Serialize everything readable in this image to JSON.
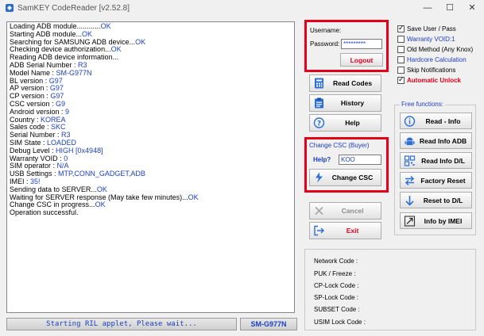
{
  "window": {
    "title": "SamKEY CodeReader [v2.52.8]",
    "minimize_glyph": "—",
    "maximize_glyph": "☐",
    "close_glyph": "✕"
  },
  "log": [
    {
      "t": "Loading ADB module............",
      "v": "OK"
    },
    {
      "t": "Starting ADB module...",
      "v": "OK"
    },
    {
      "t": "Searching for SAMSUNG ADB device...",
      "v": "OK"
    },
    {
      "t": "Checking device authorization...",
      "v": "OK"
    },
    {
      "t": "Reading ADB device information...",
      "v": ""
    },
    {
      "t": "ADB Serial Number : ",
      "v": "R3"
    },
    {
      "t": "Model Name : ",
      "v": "SM-G977N"
    },
    {
      "t": "BL version : ",
      "v": "G97"
    },
    {
      "t": "AP version : ",
      "v": "G97"
    },
    {
      "t": "CP version : ",
      "v": "G97"
    },
    {
      "t": "CSC version : ",
      "v": "G9"
    },
    {
      "t": "Android version : ",
      "v": "9"
    },
    {
      "t": "Country : ",
      "v": "KOREA"
    },
    {
      "t": "Sales code : ",
      "v": "SKC"
    },
    {
      "t": "Serial Number : ",
      "v": "R3"
    },
    {
      "t": "SIM State : ",
      "v": "LOADED"
    },
    {
      "t": "Debug Level : ",
      "v": "HIGH [0x4948]"
    },
    {
      "t": "Warranty VOID : ",
      "v": "0"
    },
    {
      "t": "SIM operator : ",
      "v": "N/A"
    },
    {
      "t": "USB Settings : ",
      "v": "MTP,CONN_GADGET,ADB"
    },
    {
      "t": "IMEI : ",
      "v": "35!"
    },
    {
      "t": "Sending data to SERVER...",
      "v": "OK"
    },
    {
      "t": "Waiting for SERVER response (May take few minutes)...",
      "v": "OK"
    },
    {
      "t": "Change CSC in progress...",
      "v": "OK"
    },
    {
      "t": "Operation successful.",
      "v": ""
    }
  ],
  "status": {
    "text": "Starting RIL applet, Please wait...",
    "model": "SM-G977N"
  },
  "login": {
    "username_label": "Username:",
    "password_label": "Password:",
    "password_value": "*********",
    "logout_label": "Logout"
  },
  "buttons": {
    "read_codes": "Read Codes",
    "history": "History",
    "help": "Help",
    "cancel": "Cancel",
    "exit": "Exit"
  },
  "change_csc": {
    "title": "Change CSC (Buyer)",
    "help_label": "Help?",
    "input_value": "KOO",
    "button": "Change CSC"
  },
  "options": [
    {
      "label": "Save User / Pass",
      "checked": true,
      "color": "#000000"
    },
    {
      "label": "Warranty VOID:1",
      "checked": false,
      "color": "#1b3fc2"
    },
    {
      "label": "Old Method (Any Knox)",
      "checked": false,
      "color": "#000000"
    },
    {
      "label": "Hardcore Calculation",
      "checked": false,
      "color": "#1b3fc2"
    },
    {
      "label": "Skip Notifications",
      "checked": false,
      "color": "#000000"
    },
    {
      "label": "Automatic Unlock",
      "checked": true,
      "color": "#e3001b"
    }
  ],
  "free_functions": {
    "title": "Free functions:",
    "read_info": "Read - Info",
    "read_info_adb": "Read Info ADB",
    "read_info_dl": "Read Info D/L",
    "factory_reset": "Factory Reset",
    "reset_to_dl": "Reset to D/L",
    "info_by_imei": "Info by IMEI"
  },
  "codes": {
    "network": "Network Code :",
    "puk": "PUK / Freeze :",
    "cp_lock": "CP-Lock Code :",
    "sp_lock": "SP-Lock Code :",
    "subset": "SUBSET Code :",
    "usim_lock": "USIM Lock Code :"
  },
  "colors": {
    "accent_blue": "#1b3fc2",
    "highlight_red": "#e3001b"
  }
}
